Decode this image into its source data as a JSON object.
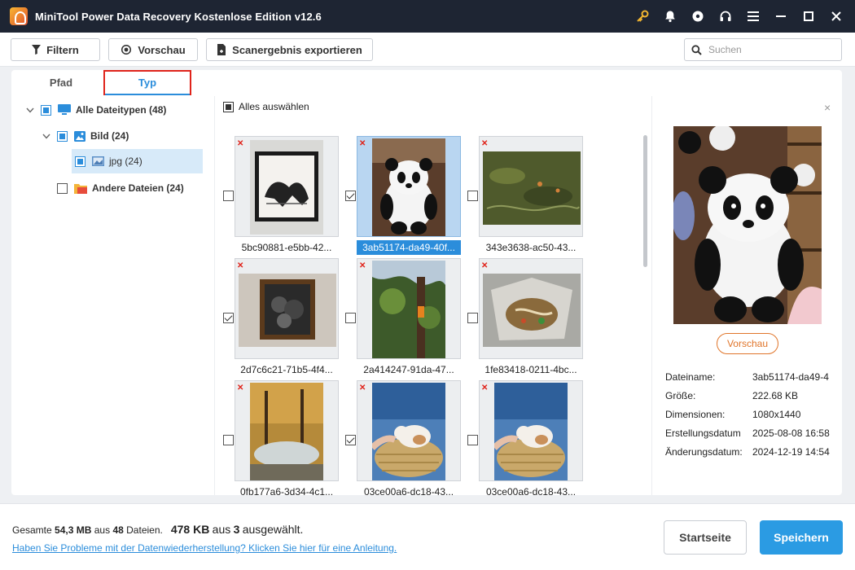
{
  "app": {
    "title": "MiniTool Power Data Recovery Kostenlose Edition v12.6"
  },
  "titlebar_icons": [
    "key-icon",
    "bell-icon",
    "disc-icon",
    "headset-icon",
    "menu-icon",
    "minimize-icon",
    "maximize-icon",
    "close-icon"
  ],
  "toolbar": {
    "filter_label": "Filtern",
    "preview_label": "Vorschau",
    "export_label": "Scanergebnis exportieren",
    "search_placeholder": "Suchen"
  },
  "tabs": [
    {
      "label": "Pfad"
    },
    {
      "label": "Typ",
      "active": true
    }
  ],
  "tree": [
    {
      "label": "Alle Dateitypen (48)",
      "icon": "monitor-icon",
      "state": "partial"
    },
    {
      "label": "Bild (24)",
      "icon": "image-icon",
      "state": "partial"
    },
    {
      "label": "jpg (24)",
      "icon": "jpg-file-icon",
      "state": "partial",
      "selected": true
    },
    {
      "label": "Andere Dateien (24)",
      "icon": "folder-icon",
      "state": "unchecked"
    }
  ],
  "grid": {
    "select_all_label": "Alles auswählen",
    "files": [
      {
        "name": "5bc90881-e5bb-42...",
        "checked": false,
        "selected": false,
        "deleted": true
      },
      {
        "name": "3ab51174-da49-40f...",
        "checked": true,
        "selected": true,
        "deleted": true
      },
      {
        "name": "343e3638-ac50-43...",
        "checked": false,
        "selected": false,
        "deleted": true
      },
      {
        "name": "2d7c6c21-71b5-4f4...",
        "checked": true,
        "selected": false,
        "deleted": true
      },
      {
        "name": "2a414247-91da-47...",
        "checked": false,
        "selected": false,
        "deleted": true
      },
      {
        "name": "1fe83418-0211-4bc...",
        "checked": false,
        "selected": false,
        "deleted": true
      },
      {
        "name": "0fb177a6-3d34-4c1...",
        "checked": false,
        "selected": false,
        "deleted": true
      },
      {
        "name": "03ce00a6-dc18-43...",
        "checked": true,
        "selected": false,
        "deleted": true
      },
      {
        "name": "03ce00a6-dc18-43...",
        "checked": false,
        "selected": false,
        "deleted": true
      }
    ]
  },
  "preview": {
    "button_label": "Vorschau",
    "close_glyph": "×",
    "props": [
      {
        "key": "Dateiname:",
        "value": "3ab51174-da49-4"
      },
      {
        "key": "Größe:",
        "value": "222.68 KB"
      },
      {
        "key": "Dimensionen:",
        "value": "1080x1440"
      },
      {
        "key": "Erstellungsdatum",
        "value": "2025-08-08 16:58"
      },
      {
        "key": "Änderungsdatum:",
        "value": "2024-12-19 14:54"
      }
    ]
  },
  "footer": {
    "total_prefix": "Gesamte",
    "total_size": "54,3 MB",
    "total_mid": "aus",
    "total_count": "48",
    "total_suffix": "Dateien.",
    "selected_size": "478 KB",
    "selected_mid": "aus",
    "selected_count": "3",
    "selected_suffix": "ausgewählt.",
    "help_link": "Haben Sie Probleme mit der Datenwiederherstellung? Klicken Sie hier für eine Anleitung.",
    "home_button": "Startseite",
    "save_button": "Speichern"
  },
  "colors": {
    "accent": "#2b8ddb",
    "save": "#2b9be3",
    "titlebar": "#1e2533",
    "highlight": "#e0241b",
    "preview": "#e0752a"
  }
}
